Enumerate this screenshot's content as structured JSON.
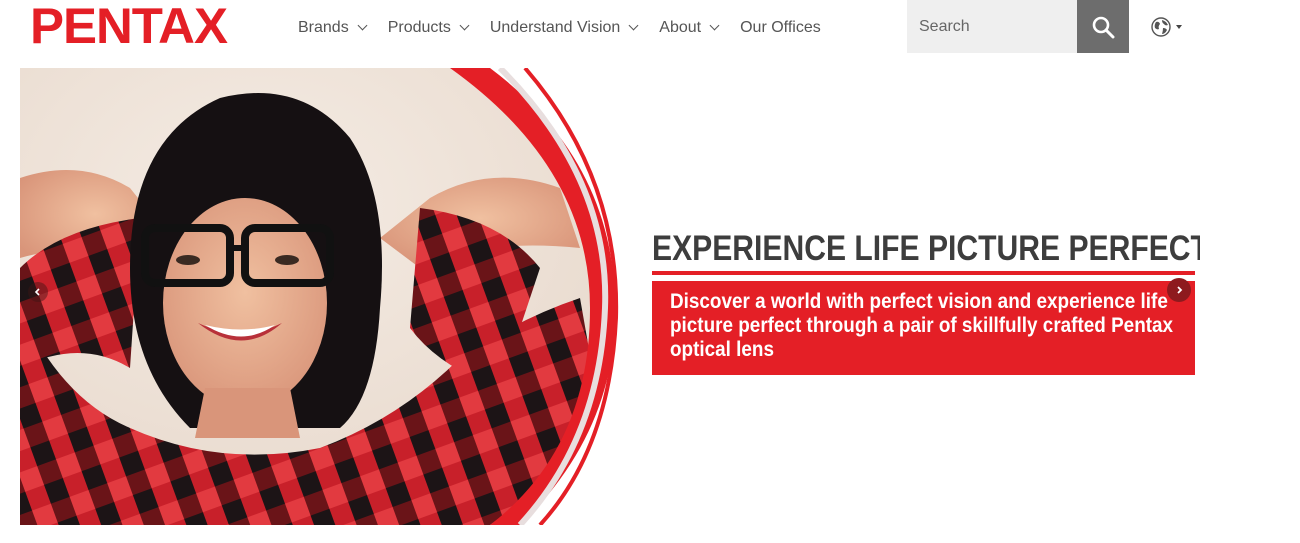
{
  "brand": {
    "logo_text": "PENTAX",
    "color": "#e41f26"
  },
  "nav": {
    "items": [
      {
        "label": "Brands",
        "has_dropdown": true
      },
      {
        "label": "Products",
        "has_dropdown": true
      },
      {
        "label": "Understand Vision",
        "has_dropdown": true
      },
      {
        "label": "About",
        "has_dropdown": true
      },
      {
        "label": "Our Offices",
        "has_dropdown": false
      }
    ]
  },
  "search": {
    "placeholder": "Search",
    "button_icon": "search-icon"
  },
  "language": {
    "icon": "globe-icon"
  },
  "hero": {
    "headline": "EXPERIENCE LIFE PICTURE PERFECT",
    "tagline": "Discover a world with perfect vision and experience life picture perfect through a pair of skillfully crafted Pentax optical lens",
    "accent_color": "#e41f26",
    "image_subject": "smiling woman with black glasses and red plaid shirt"
  }
}
